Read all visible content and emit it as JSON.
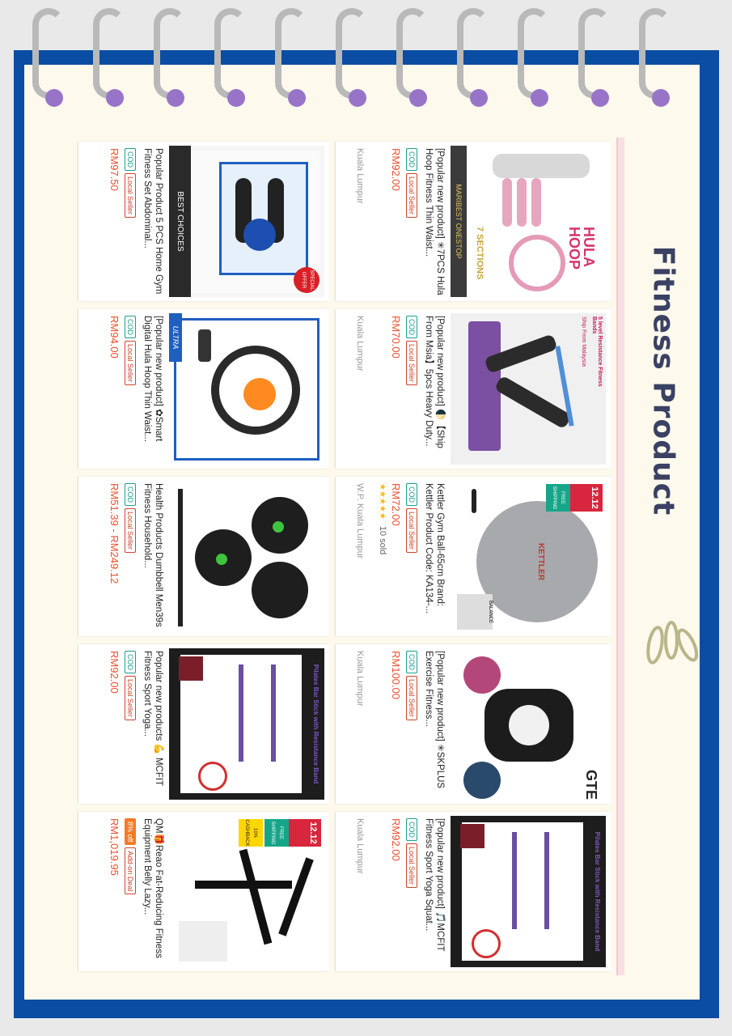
{
  "heading": "Fitness Product",
  "labels": {
    "cod": "COD",
    "local_seller": "Local Seller",
    "add_on_deal": "Add-on Deal"
  },
  "image_texts": {
    "hula_hoop": "HULA HOOP",
    "maribest": "MARIBEST ONESTOP",
    "sections": "7 SECTIONS",
    "resistance_band": "5 level Resistance Fitness Bands",
    "ship_from": "Ship From Malaysia",
    "kettler": "KETTLER",
    "promo_1212": "12.12",
    "free_shipping": "FREE SHIPPING",
    "balance": "BALANCE",
    "gte": "GTE",
    "pilates_bar": "Pilates Bar Stick with Resistance Band",
    "special_offer": "SPECIAL OFFER",
    "best_choices": "BEST CHOICES",
    "ultra": "ULTRA",
    "cashback": "10% CASHBACK"
  },
  "products_top": [
    {
      "title": "[Popular new product] ✳7PCS Hula Hoop Fitness Thin Waist...",
      "price": "RM92.00",
      "location": "Kuala Lumpur",
      "tags": [
        "COD",
        "Local Seller"
      ]
    },
    {
      "title": "[Popular new product] 🌓【Ship From Msia】5pcs Heavy Duty...",
      "price": "RM70.00",
      "location": "Kuala Lumpur",
      "tags": [
        "COD",
        "Local Seller"
      ]
    },
    {
      "title": "Kettler Gym Ball-65cm Brand: Kettler Product Code: KA134-...",
      "price": "RM72.00",
      "rating": "★★★★★",
      "sold": "10 sold",
      "location": "W.P. Kuala Lumpur",
      "tags": [
        "COD",
        "Local Seller"
      ]
    },
    {
      "title": "[Popular new product] ✳SKPLUS Exercise Fitness...",
      "price": "RM100.00",
      "location": "Kuala Lumpur",
      "tags": [
        "COD",
        "Local Seller"
      ]
    },
    {
      "title": "[Popular new product] 🎵MCFIT Fitness Sport Yoga Squat...",
      "price": "RM92.00",
      "location": "Kuala Lumpur",
      "tags": [
        "COD",
        "Local Seller"
      ]
    }
  ],
  "products_bottom": [
    {
      "title": "Popular Product 5 PCS Home Gym Fitness Set Abdominal...",
      "price": "RM97.50",
      "tags": [
        "COD",
        "Local Seller"
      ]
    },
    {
      "title": "[Popular new product] ✿Smart Digital Hula Hoop Thin Waist...",
      "price": "RM94.00",
      "tags": [
        "COD",
        "Local Seller"
      ]
    },
    {
      "title": "Health Products Dumbbell Men39s Fitness Household...",
      "price": "RM51.39 - RM249.12",
      "tags": [
        "COD",
        "Local Seller"
      ]
    },
    {
      "title": "Popular new products 💪 MCFIT Fitness Sport Yoga...",
      "price": "RM92.00",
      "tags": [
        "COD",
        "Local Seller"
      ]
    },
    {
      "title": "QM🎁Reao Fat-Reducing Fitness Equipment Belly Lazy...",
      "price": "RM1,019.95",
      "tags": [
        "8% off",
        "Add-on Deal"
      ]
    }
  ]
}
